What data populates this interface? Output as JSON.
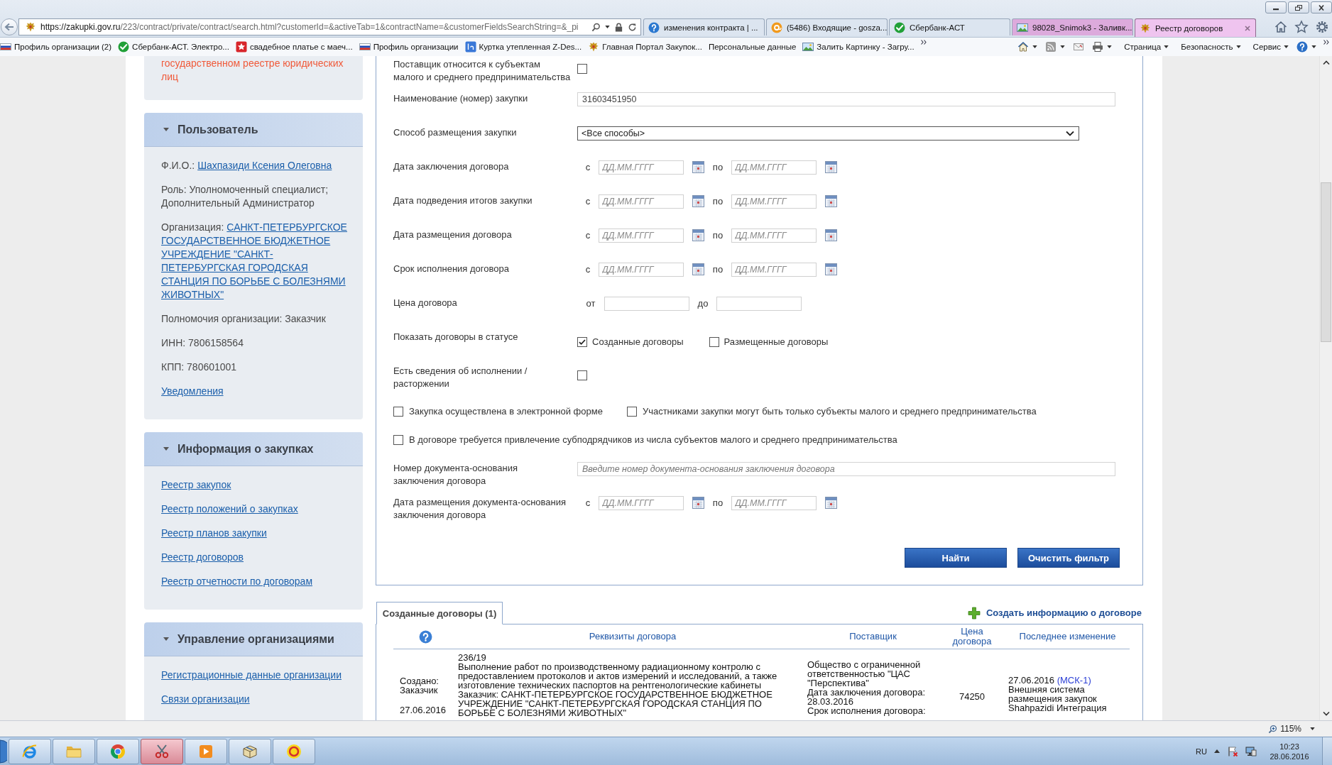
{
  "browser": {
    "address": {
      "host": "https://zakupki.gov.ru",
      "path": "/223/contract/private/contract/search.html?customerId=&activeTab=1&contractName=&customerFieldsSearchString=&_pi"
    },
    "tabs": [
      {
        "label": "изменения контракта | ...",
        "selected": false,
        "color": "#dce5f0"
      },
      {
        "label": "(5486) Входящие - gosza...",
        "selected": false,
        "color": "#dce5f0"
      },
      {
        "label": "Сбербанк-АСТ",
        "selected": false,
        "color": "#dce5f0"
      },
      {
        "label": "98028_Snimok3 - Заливк...",
        "selected": false,
        "color": "#dcaadc"
      },
      {
        "label": "Реестр договоров",
        "selected": true,
        "color": "#efc4ef"
      }
    ],
    "bookmarks": [
      "Профиль организации (2)",
      "Сбербанк-АСТ. Электро...",
      "свадебное платье с маеч...",
      "Профиль организации",
      "Куртка утепленная Z-Des...",
      "Главная Портал Закупок...",
      "Персональные данные",
      "Залить Картинку - Загру..."
    ],
    "commands": [
      "Страница",
      "Безопасность",
      "Сервис"
    ]
  },
  "sidebar": {
    "notice": "государственном реестре юридических лиц",
    "panels": [
      {
        "title": "Пользователь",
        "expanded": true,
        "items": [
          {
            "kind": "field",
            "label": "Ф.И.О.:",
            "link": "Шахпазиди Ксения Олеговна"
          },
          {
            "kind": "text",
            "text": "Роль: Уполномоченный специалист; Дополнительный Администратор"
          },
          {
            "kind": "field",
            "label": "Организация:",
            "link": "САНКТ-ПЕТЕРБУРГСКОЕ ГОСУДАРСТВЕННОЕ БЮДЖЕТНОЕ УЧРЕЖДЕНИЕ \"САНКТ-ПЕТЕРБУРГСКАЯ ГОРОДСКАЯ СТАНЦИЯ ПО БОРЬБЕ С БОЛЕЗНЯМИ ЖИВОТНЫХ\""
          },
          {
            "kind": "text",
            "text": "Полномочия организации: Заказчик"
          },
          {
            "kind": "text",
            "text": "ИНН: 7806158564"
          },
          {
            "kind": "text",
            "text": "КПП: 780601001"
          },
          {
            "kind": "link",
            "text": "Уведомления"
          }
        ]
      },
      {
        "title": "Информация о закупках",
        "expanded": true,
        "items": [
          {
            "kind": "link",
            "text": "Реестр закупок"
          },
          {
            "kind": "link",
            "text": "Реестр положений о закупках"
          },
          {
            "kind": "link",
            "text": "Реестр планов закупки"
          },
          {
            "kind": "link",
            "text": "Реестр договоров"
          },
          {
            "kind": "link",
            "text": "Реестр отчетности по договорам"
          }
        ]
      },
      {
        "title": "Управление организациями",
        "expanded": true,
        "items": [
          {
            "kind": "link",
            "text": "Регистрационные данные организации"
          },
          {
            "kind": "link",
            "text": "Связи организации"
          }
        ]
      }
    ]
  },
  "filter": {
    "rows": [
      {
        "kind": "checkbox",
        "label": "Поставщик относится к субъектам малого и среднего предпринимательства",
        "checked": false
      },
      {
        "kind": "text",
        "label": "Наименование (номер) закупки",
        "value": "31603451950"
      },
      {
        "kind": "select",
        "label": "Способ размещения закупки",
        "value": "<Все способы>"
      },
      {
        "kind": "date_range",
        "label": "Дата заключения договора",
        "from_label": "с",
        "from_placeholder": "ДД.ММ.ГГГГ",
        "to_label": "по",
        "to_placeholder": "ДД.ММ.ГГГГ"
      },
      {
        "kind": "date_range",
        "label": "Дата подведения итогов закупки",
        "from_label": "с",
        "from_placeholder": "ДД.ММ.ГГГГ",
        "to_label": "по",
        "to_placeholder": "ДД.ММ.ГГГГ"
      },
      {
        "kind": "date_range",
        "label": "Дата размещения договора",
        "from_label": "с",
        "from_placeholder": "ДД.ММ.ГГГГ",
        "to_label": "по",
        "to_placeholder": "ДД.ММ.ГГГГ"
      },
      {
        "kind": "date_range",
        "label": "Срок исполнения договора",
        "from_label": "с",
        "from_placeholder": "ДД.ММ.ГГГГ",
        "to_label": "по",
        "to_placeholder": "ДД.ММ.ГГГГ"
      },
      {
        "kind": "range",
        "label": "Цена договора",
        "from_label": "от",
        "to_label": "до"
      },
      {
        "kind": "options",
        "label": "Показать договоры в статусе",
        "options": [
          {
            "label": "Созданные договоры",
            "checked": true
          },
          {
            "label": "Размещенные договоры",
            "checked": false
          }
        ]
      },
      {
        "kind": "checkbox",
        "label": "Есть сведения об исполнении / расторжении",
        "checked": false
      },
      {
        "kind": "flags",
        "options": [
          {
            "label": "Закупка осуществлена в электронной форме",
            "checked": false
          },
          {
            "label": "Участниками закупки могут быть только субъекты малого и среднего предпринимательства",
            "checked": false
          }
        ]
      },
      {
        "kind": "flags",
        "options": [
          {
            "label": "В договоре требуется привлечение субподрядчиков из числа субъектов малого и среднего предпринимательства",
            "checked": false
          }
        ]
      },
      {
        "kind": "text",
        "label": "Номер документа-основания заключения договора",
        "placeholder": "Введите номер документа-основания заключения договора"
      },
      {
        "kind": "date_range",
        "label": "Дата размещения документа-основания заключения договора",
        "from_label": "с",
        "from_placeholder": "ДД.ММ.ГГГГ",
        "to_label": "по",
        "to_placeholder": "ДД.ММ.ГГГГ"
      }
    ],
    "buttons": [
      "Найти",
      "Очистить фильтр"
    ]
  },
  "results": {
    "tabs": [
      {
        "label": "Созданные договоры (1)",
        "selected": true
      }
    ],
    "create_link": "Создать информацию о договоре",
    "columns": [
      "Реквизиты договора",
      "Поставщик",
      "Цена договора",
      "Последнее изменение"
    ],
    "rows": [
      {
        "status": "Создано: Заказчик",
        "date": "27.06.2016",
        "number": "236/19",
        "subject": "Выполнение работ по производственному радиационному контролю с предоставлением протоколов и актов измерений и исследований, а также изготовление технических паспортов на рентгенологические кабинеты",
        "customer": "Заказчик: САНКТ-ПЕТЕРБУРГСКОЕ ГОСУДАРСТВЕННОЕ БЮДЖЕТНОЕ УЧРЕЖДЕНИЕ \"САНКТ-ПЕТЕРБУРГСКАЯ ГОРОДСКАЯ СТАНЦИЯ ПО БОРЬБЕ С БОЛЕЗНЯМИ ЖИВОТНЫХ\"",
        "supplier": "Общество с ограниченной ответственностью \"ЦАС \"Перспектива\"",
        "contract_date": "Дата заключения договора: 28.03.2016",
        "term": "Срок исполнения договора:",
        "price": "74250",
        "changed": "27.06.2016",
        "timezone": "(МСК-1)",
        "system": "Внешняя система размещения закупок",
        "user": "Shahpazidi Интеграция"
      }
    ]
  },
  "status_bar": {
    "zoom": "115%"
  },
  "taskbar": {
    "apps": [
      {
        "selected": false
      },
      {
        "selected": false
      },
      {
        "selected": false
      },
      {
        "selected": true
      },
      {
        "selected": false
      },
      {
        "selected": false
      },
      {
        "selected": false
      }
    ],
    "language": "RU",
    "time": "10:23",
    "date": "28.06.2016"
  }
}
